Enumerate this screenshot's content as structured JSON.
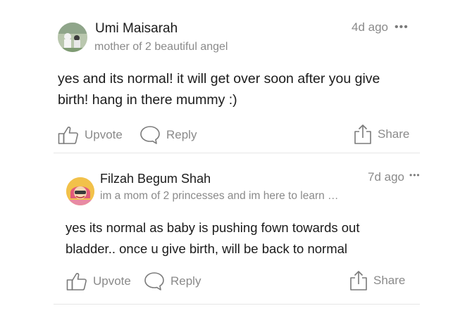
{
  "comments": [
    {
      "author": "Umi Maisarah",
      "bio": "mother of 2 beautiful angel",
      "time": "4d ago",
      "more": "•••",
      "body": "yes and its normal! it will get over soon after you give birth! hang in there mummy :)",
      "actions": {
        "upvote": "Upvote",
        "reply": "Reply",
        "share": "Share"
      }
    },
    {
      "author": "Filzah Begum Shah",
      "bio": "im a mom of 2 princesses and im here to learn …",
      "time": "7d ago",
      "more": "•••",
      "body": "yes its normal as baby is pushing fown towards out bladder.. once u give birth, will be back to normal",
      "actions": {
        "upvote": "Upvote",
        "reply": "Reply",
        "share": "Share"
      }
    }
  ],
  "icons": {
    "upvote": "thumbs-up-icon",
    "reply": "speech-bubble-icon",
    "share": "share-upload-icon"
  },
  "colors": {
    "text": "#1b1b1b",
    "muted": "#8a8a8a",
    "icon": "#7a7a7a",
    "divider": "#e6e6e6"
  }
}
